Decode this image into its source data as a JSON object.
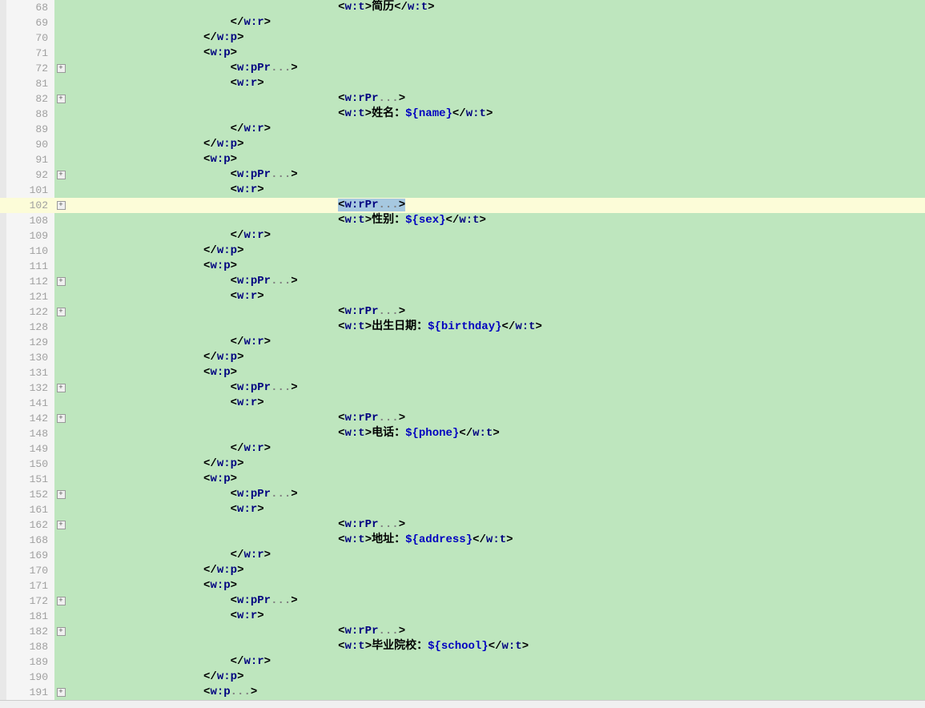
{
  "lines": [
    {
      "n": "68",
      "fold": "bar",
      "indent": 20,
      "hl": false,
      "kind": "wt",
      "text": "简历",
      "var": ""
    },
    {
      "n": "69",
      "fold": "bar",
      "indent": 12,
      "hl": false,
      "kind": "close",
      "tag": "w:r"
    },
    {
      "n": "70",
      "fold": "bar",
      "indent": 10,
      "hl": false,
      "kind": "close",
      "tag": "w:p"
    },
    {
      "n": "71",
      "fold": "bar",
      "indent": 10,
      "hl": false,
      "kind": "open",
      "tag": "w:p"
    },
    {
      "n": "72",
      "fold": "plus",
      "indent": 12,
      "hl": false,
      "kind": "fold",
      "tag": "w:pPr"
    },
    {
      "n": "81",
      "fold": "bar",
      "indent": 12,
      "hl": false,
      "kind": "open",
      "tag": "w:r"
    },
    {
      "n": "82",
      "fold": "plus",
      "indent": 20,
      "hl": false,
      "kind": "fold",
      "tag": "w:rPr"
    },
    {
      "n": "88",
      "fold": "bar",
      "indent": 20,
      "hl": false,
      "kind": "wt",
      "text": "姓名：",
      "var": "${name}"
    },
    {
      "n": "89",
      "fold": "bar",
      "indent": 12,
      "hl": false,
      "kind": "close",
      "tag": "w:r"
    },
    {
      "n": "90",
      "fold": "bar",
      "indent": 10,
      "hl": false,
      "kind": "close",
      "tag": "w:p"
    },
    {
      "n": "91",
      "fold": "bar",
      "indent": 10,
      "hl": false,
      "kind": "open",
      "tag": "w:p"
    },
    {
      "n": "92",
      "fold": "plus",
      "indent": 12,
      "hl": false,
      "kind": "fold",
      "tag": "w:pPr"
    },
    {
      "n": "101",
      "fold": "bar",
      "indent": 12,
      "hl": false,
      "kind": "open",
      "tag": "w:r"
    },
    {
      "n": "102",
      "fold": "plus",
      "indent": 20,
      "hl": true,
      "kind": "fold",
      "tag": "w:rPr",
      "selected": true
    },
    {
      "n": "108",
      "fold": "bar",
      "indent": 20,
      "hl": false,
      "kind": "wt",
      "text": "性别：",
      "var": "${sex}"
    },
    {
      "n": "109",
      "fold": "bar",
      "indent": 12,
      "hl": false,
      "kind": "close",
      "tag": "w:r"
    },
    {
      "n": "110",
      "fold": "bar",
      "indent": 10,
      "hl": false,
      "kind": "close",
      "tag": "w:p"
    },
    {
      "n": "111",
      "fold": "bar",
      "indent": 10,
      "hl": false,
      "kind": "open",
      "tag": "w:p"
    },
    {
      "n": "112",
      "fold": "plus",
      "indent": 12,
      "hl": false,
      "kind": "fold",
      "tag": "w:pPr"
    },
    {
      "n": "121",
      "fold": "bar",
      "indent": 12,
      "hl": false,
      "kind": "open",
      "tag": "w:r"
    },
    {
      "n": "122",
      "fold": "plus",
      "indent": 20,
      "hl": false,
      "kind": "fold",
      "tag": "w:rPr"
    },
    {
      "n": "128",
      "fold": "bar",
      "indent": 20,
      "hl": false,
      "kind": "wt",
      "text": "出生日期：",
      "var": "${birthday}"
    },
    {
      "n": "129",
      "fold": "bar",
      "indent": 12,
      "hl": false,
      "kind": "close",
      "tag": "w:r"
    },
    {
      "n": "130",
      "fold": "bar",
      "indent": 10,
      "hl": false,
      "kind": "close",
      "tag": "w:p"
    },
    {
      "n": "131",
      "fold": "bar",
      "indent": 10,
      "hl": false,
      "kind": "open",
      "tag": "w:p"
    },
    {
      "n": "132",
      "fold": "plus",
      "indent": 12,
      "hl": false,
      "kind": "fold",
      "tag": "w:pPr"
    },
    {
      "n": "141",
      "fold": "bar",
      "indent": 12,
      "hl": false,
      "kind": "open",
      "tag": "w:r"
    },
    {
      "n": "142",
      "fold": "plus",
      "indent": 20,
      "hl": false,
      "kind": "fold",
      "tag": "w:rPr"
    },
    {
      "n": "148",
      "fold": "bar",
      "indent": 20,
      "hl": false,
      "kind": "wt",
      "text": "电话：",
      "var": "${phone}"
    },
    {
      "n": "149",
      "fold": "bar",
      "indent": 12,
      "hl": false,
      "kind": "close",
      "tag": "w:r"
    },
    {
      "n": "150",
      "fold": "bar",
      "indent": 10,
      "hl": false,
      "kind": "close",
      "tag": "w:p"
    },
    {
      "n": "151",
      "fold": "bar",
      "indent": 10,
      "hl": false,
      "kind": "open",
      "tag": "w:p"
    },
    {
      "n": "152",
      "fold": "plus",
      "indent": 12,
      "hl": false,
      "kind": "fold",
      "tag": "w:pPr"
    },
    {
      "n": "161",
      "fold": "bar",
      "indent": 12,
      "hl": false,
      "kind": "open",
      "tag": "w:r"
    },
    {
      "n": "162",
      "fold": "plus",
      "indent": 20,
      "hl": false,
      "kind": "fold",
      "tag": "w:rPr"
    },
    {
      "n": "168",
      "fold": "bar",
      "indent": 20,
      "hl": false,
      "kind": "wt",
      "text": "地址：",
      "var": "${address}"
    },
    {
      "n": "169",
      "fold": "bar",
      "indent": 12,
      "hl": false,
      "kind": "close",
      "tag": "w:r"
    },
    {
      "n": "170",
      "fold": "bar",
      "indent": 10,
      "hl": false,
      "kind": "close",
      "tag": "w:p"
    },
    {
      "n": "171",
      "fold": "bar",
      "indent": 10,
      "hl": false,
      "kind": "open",
      "tag": "w:p"
    },
    {
      "n": "172",
      "fold": "plus",
      "indent": 12,
      "hl": false,
      "kind": "fold",
      "tag": "w:pPr"
    },
    {
      "n": "181",
      "fold": "bar",
      "indent": 12,
      "hl": false,
      "kind": "open",
      "tag": "w:r"
    },
    {
      "n": "182",
      "fold": "plus",
      "indent": 20,
      "hl": false,
      "kind": "fold",
      "tag": "w:rPr"
    },
    {
      "n": "188",
      "fold": "bar",
      "indent": 20,
      "hl": false,
      "kind": "wt",
      "text": "毕业院校：",
      "var": "${school}"
    },
    {
      "n": "189",
      "fold": "bar",
      "indent": 12,
      "hl": false,
      "kind": "close",
      "tag": "w:r"
    },
    {
      "n": "190",
      "fold": "bar",
      "indent": 10,
      "hl": false,
      "kind": "close",
      "tag": "w:p"
    },
    {
      "n": "191",
      "fold": "plus",
      "indent": 10,
      "hl": false,
      "kind": "fold",
      "tag": "w:p"
    }
  ],
  "glyphs": {
    "plus": "+",
    "minus": "−",
    "bar": "│"
  }
}
